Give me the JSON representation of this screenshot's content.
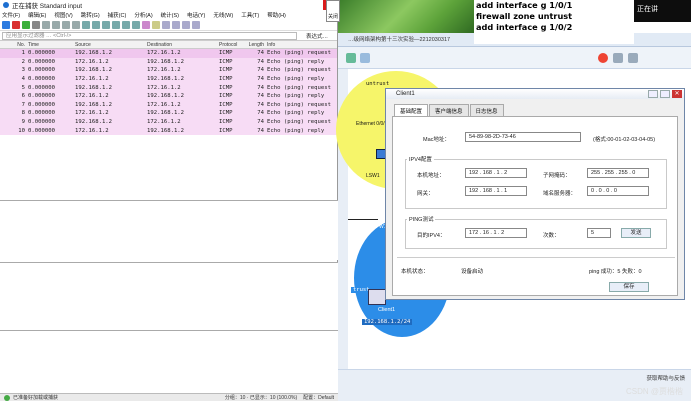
{
  "wireshark": {
    "title": "正在捕获 Standard input",
    "menu": [
      "文件(F)",
      "编辑(E)",
      "视图(V)",
      "跳转(G)",
      "捕获(C)",
      "分析(A)",
      "统计(S)",
      "电话(Y)",
      "无线(W)",
      "工具(T)",
      "帮助(H)"
    ],
    "filter_placeholder": "应用显示过滤器 … <Ctrl-/>",
    "filter_expr": "表达式…",
    "columns": [
      "No.",
      "Time",
      "Source",
      "Destination",
      "Protocol",
      "Length",
      "Info"
    ],
    "packets": [
      {
        "no": "1",
        "time": "0.000000",
        "src": "192.168.1.2",
        "dst": "172.16.1.2",
        "proto": "ICMP",
        "len": "74",
        "info": "Echo (ping) request"
      },
      {
        "no": "2",
        "time": "0.000000",
        "src": "172.16.1.2",
        "dst": "192.168.1.2",
        "proto": "ICMP",
        "len": "74",
        "info": "Echo (ping) reply"
      },
      {
        "no": "3",
        "time": "0.000000",
        "src": "192.168.1.2",
        "dst": "172.16.1.2",
        "proto": "ICMP",
        "len": "74",
        "info": "Echo (ping) request"
      },
      {
        "no": "4",
        "time": "0.000000",
        "src": "172.16.1.2",
        "dst": "192.168.1.2",
        "proto": "ICMP",
        "len": "74",
        "info": "Echo (ping) reply"
      },
      {
        "no": "5",
        "time": "0.000000",
        "src": "192.168.1.2",
        "dst": "172.16.1.2",
        "proto": "ICMP",
        "len": "74",
        "info": "Echo (ping) request"
      },
      {
        "no": "6",
        "time": "0.000000",
        "src": "172.16.1.2",
        "dst": "192.168.1.2",
        "proto": "ICMP",
        "len": "74",
        "info": "Echo (ping) reply"
      },
      {
        "no": "7",
        "time": "0.000000",
        "src": "192.168.1.2",
        "dst": "172.16.1.2",
        "proto": "ICMP",
        "len": "74",
        "info": "Echo (ping) request"
      },
      {
        "no": "8",
        "time": "0.000000",
        "src": "172.16.1.2",
        "dst": "192.168.1.2",
        "proto": "ICMP",
        "len": "74",
        "info": "Echo (ping) reply"
      },
      {
        "no": "9",
        "time": "0.000000",
        "src": "192.168.1.2",
        "dst": "172.16.1.2",
        "proto": "ICMP",
        "len": "74",
        "info": "Echo (ping) request"
      },
      {
        "no": "10",
        "time": "0.000000",
        "src": "172.16.1.2",
        "dst": "192.168.1.2",
        "proto": "ICMP",
        "len": "74",
        "info": "Echo (ping) reply"
      }
    ],
    "status_left": "已准备好加载或捕获",
    "status_right": "分组：10 · 已显示：10 (100.0%)",
    "profile": "配置：Default"
  },
  "terminal": {
    "lines": [
      "add interface g 1/0/1",
      "firewall zone untrust",
      "add interface g 1/0/2"
    ]
  },
  "side_tab": "正在讲",
  "close_tab": "关闭",
  "ensp": {
    "window_title": "…级网络架构第十三次实验—2212030317",
    "untrust_label": "untrust",
    "trust_label": "trust",
    "client_label": "Client1",
    "client_ip": "192.168.1.2/24",
    "link_label": "Ethernet 0/0/1",
    "device_labels": [
      "LSW1",
      "FW1",
      "GE 1/0/0"
    ],
    "help_text": "获取帮助与反馈",
    "watermark": "CSDN @贾楷楷"
  },
  "dialog": {
    "title": "Client1",
    "tabs": [
      "基础配置",
      "客户端信息",
      "日志信息"
    ],
    "mac_label": "Mac地址：",
    "mac_value": "54-89-98-2D-73-46",
    "mac_hint": "(格式:00-01-02-03-04-05)",
    "ipv4_group": "IPV4配置",
    "ip_label": "本机地址：",
    "ip_value": "192 . 168 . 1 . 2",
    "mask_label": "子网掩码：",
    "mask_value": "255 . 255 . 255 . 0",
    "gw_label": "网关：",
    "gw_value": "192 . 168 . 1 . 1",
    "dns_label": "域名服务器：",
    "dns_value": "0 . 0 . 0 . 0",
    "ping_group": "PING测试",
    "dest_label": "目的IPV4：",
    "dest_value": "172 . 16 . 1 . 2",
    "count_label": "次数：",
    "count_value": "5",
    "send_button": "发送",
    "state_label": "本机状态：",
    "state_value": "设备启动",
    "ping_result": "ping 成功：5    失败：0",
    "save_button": "保存"
  }
}
